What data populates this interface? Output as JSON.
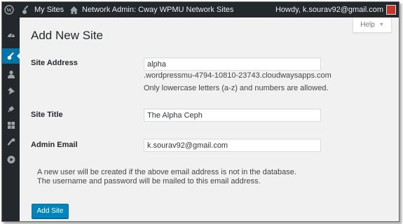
{
  "adminbar": {
    "my_sites": "My Sites",
    "network_admin": "Network Admin: Cway WPMU Network Sites",
    "howdy": "Howdy, k.sourav92@gmail.com"
  },
  "sidemenu": {
    "items": [
      {
        "icon": "dashboard-icon"
      },
      {
        "icon": "key-icon",
        "active": true
      },
      {
        "icon": "user-icon"
      },
      {
        "icon": "pin-icon"
      },
      {
        "icon": "plugin-icon"
      },
      {
        "icon": "grid-icon"
      },
      {
        "icon": "wrench-icon"
      },
      {
        "icon": "play-circle-icon"
      }
    ]
  },
  "help_tab": "Help",
  "page": {
    "title": "Add New Site"
  },
  "form": {
    "site_address": {
      "label": "Site Address",
      "value": "alpha",
      "domain_suffix": ".wordpressmu-4794-10810-23743.cloudwaysapps.com",
      "hint": "Only lowercase letters (a-z) and numbers are allowed."
    },
    "site_title": {
      "label": "Site Title",
      "value": "The Alpha Ceph"
    },
    "admin_email": {
      "label": "Admin Email",
      "value": "k.sourav92@gmail.com"
    },
    "info_line1": "A new user will be created if the above email address is not in the database.",
    "info_line2": "The username and password will be mailed to this email address.",
    "submit": "Add Site"
  },
  "colors": {
    "adminbar_bg": "#23282d",
    "active_menu": "#0073aa",
    "primary_button": "#0085ba",
    "content_bg": "#f1f1f1"
  }
}
